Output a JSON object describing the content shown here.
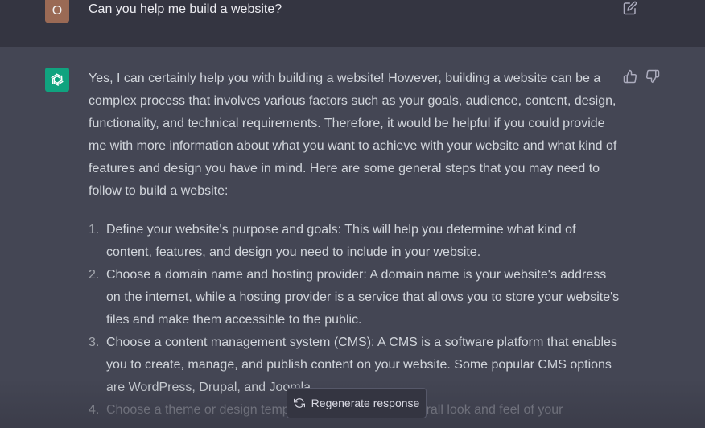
{
  "user": {
    "avatar_letter": "O",
    "message": "Can you help me build a website?"
  },
  "assistant": {
    "intro": "Yes, I can certainly help you with building a website! However, building a website can be a complex process that involves various factors such as your goals, audience, content, design, functionality, and technical requirements. Therefore, it would be helpful if you could provide me with more information about what you want to achieve with your website and what kind of features and design you have in mind. Here are some general steps that you may need to follow to build a website:",
    "steps": [
      {
        "num": "1.",
        "text": "Define your website's purpose and goals: This will help you determine what kind of content, features, and design you need to include in your website."
      },
      {
        "num": "2.",
        "text": "Choose a domain name and hosting provider: A domain name is your website's address on the internet, while a hosting provider is a service that allows you to store your website's files and make them accessible to the public."
      },
      {
        "num": "3.",
        "text": "Choose a content management system (CMS): A CMS is a software platform that enables you to create, manage, and publish content on your website. Some popular CMS options are WordPress, Drupal, and Joomla."
      },
      {
        "num": "4.",
        "text": "Choose a theme or design template that reflects the overall look and feel of your"
      }
    ]
  },
  "regenerate": {
    "label": "Regenerate response"
  },
  "icons": {
    "edit": "edit-icon",
    "thumb_up": "thumbs-up-icon",
    "thumb_down": "thumbs-down-icon",
    "regenerate": "refresh-icon",
    "assistant_logo": "openai-logo-icon"
  },
  "colors": {
    "user_row_bg": "#343541",
    "assistant_row_bg": "#444654",
    "assistant_avatar_bg": "#10a37f",
    "user_avatar_bg": "#9a6a55"
  }
}
